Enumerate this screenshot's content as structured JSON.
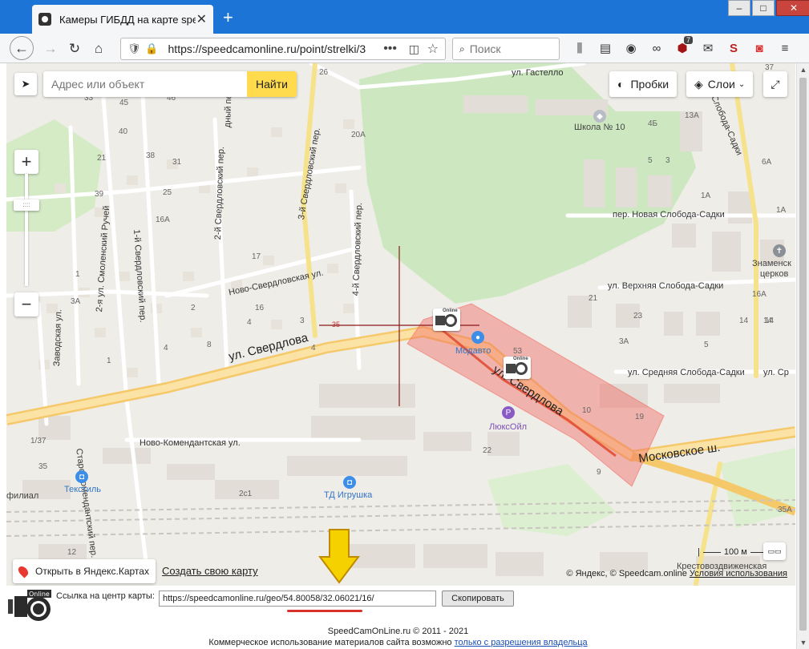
{
  "browser": {
    "tab_title": "Камеры ГИБДД на карте speedcam",
    "tab_close": "✕",
    "new_tab": "+",
    "url": "https://speedcamonline.ru/point/strelki/3",
    "search_placeholder": "Поиск",
    "toolbar_badge": "7",
    "window_minimize": "–",
    "window_maximize": "□",
    "window_close": "✕"
  },
  "map": {
    "search_placeholder": "Адрес или объект",
    "search_button": "Найти",
    "traffic_button": "Пробки",
    "layers_button": "Слои",
    "zoom_in": "+",
    "zoom_out": "−",
    "open_yandex": "Открыть в Яндекс.Картах",
    "create_map": "Создать свою карту",
    "attribution": "© Яндекс, © Speedcam.online",
    "terms": "Условия использования",
    "scale_label": "100 м",
    "streets": {
      "sverdlova": "ул. Свердлова",
      "sverdlova2": "ул. Свердлова",
      "moskovskoe": "Московское ш.",
      "novo_sverdlovskaya": "Ново-Свердловская ул.",
      "novo_komendantskaya": "Ново-Комендантская ул.",
      "staro_komendantskiy": "Старо-Комендантский пер.",
      "zavodskaya": "Заводская ул.",
      "smolensky_ruchei": "2-я ул. Смоленский Ручей",
      "pervyi_sverdl": "1-й Свердловский пер.",
      "vtoroi_sverdl": "2-й Свердловский пер.",
      "tretii_sverdl": "3-й Свердловский пер.",
      "chetvertyi_sverdl": "4-й Свердловский пер.",
      "gastello": "ул. Гастелло",
      "novaya_sloboda": "пер. Новая Слобода-Садки",
      "verhnyaya_sloboda": "ул. Верхняя Слобода-Садки",
      "srednyaya_sloboda": "ул. Средняя Слобода-Садки",
      "sloboda_sadki": "ул. Средняя Слобода-Садки",
      "sloboda_sadki_v": "ул. Слобода-Садки",
      "partial_ul_sr": "ул. Ср",
      "partial_per": "дный пер."
    },
    "pois": {
      "shkola": "Школа № 10",
      "modavto": "Модавто",
      "luksoil": "ЛюксОйл",
      "tekstil": "Текстиль",
      "td_igrushka": "ТД Игрушка",
      "znamenskaya": "Знаменск",
      "znamenskaya2": "церков",
      "filial": "филиал",
      "krestovozdv": "Крестовоздвиженская"
    },
    "house_numbers": [
      "33",
      "45",
      "46",
      "26",
      "20A",
      "40",
      "21",
      "39",
      "38",
      "31",
      "25",
      "16A",
      "1",
      "3A",
      "17",
      "16",
      "4",
      "2",
      "3",
      "8",
      "4",
      "1",
      "1/37",
      "35",
      "2c1",
      "12",
      "53",
      "10",
      "19",
      "9",
      "22",
      "14",
      "13",
      "4Б",
      "5",
      "13A",
      "3",
      "1A",
      "6A",
      "1A",
      "16A",
      "21",
      "23",
      "3A",
      "14",
      "35A",
      "37",
      "5",
      "14",
      "4"
    ],
    "road_label": "35"
  },
  "share": {
    "label": "Ссылка на центр карты:",
    "url": "https://speedcamonline.ru/geo/54.80058/32.06021/16/",
    "copy_button": "Скопировать"
  },
  "footer": {
    "copyright": "SpeedCamOnLine.ru © 2011 - 2021",
    "commercial": "Коммерческое использование материалов сайта возможно",
    "commercial_link": "только с разрешения владельца"
  },
  "colors": {
    "accent_yellow": "#ffdb4d",
    "camera_zone": "#f26b63",
    "tab_bar": "#1c74d6",
    "highlight_arrow": "#f5d100",
    "underline_red": "#d7312a"
  }
}
